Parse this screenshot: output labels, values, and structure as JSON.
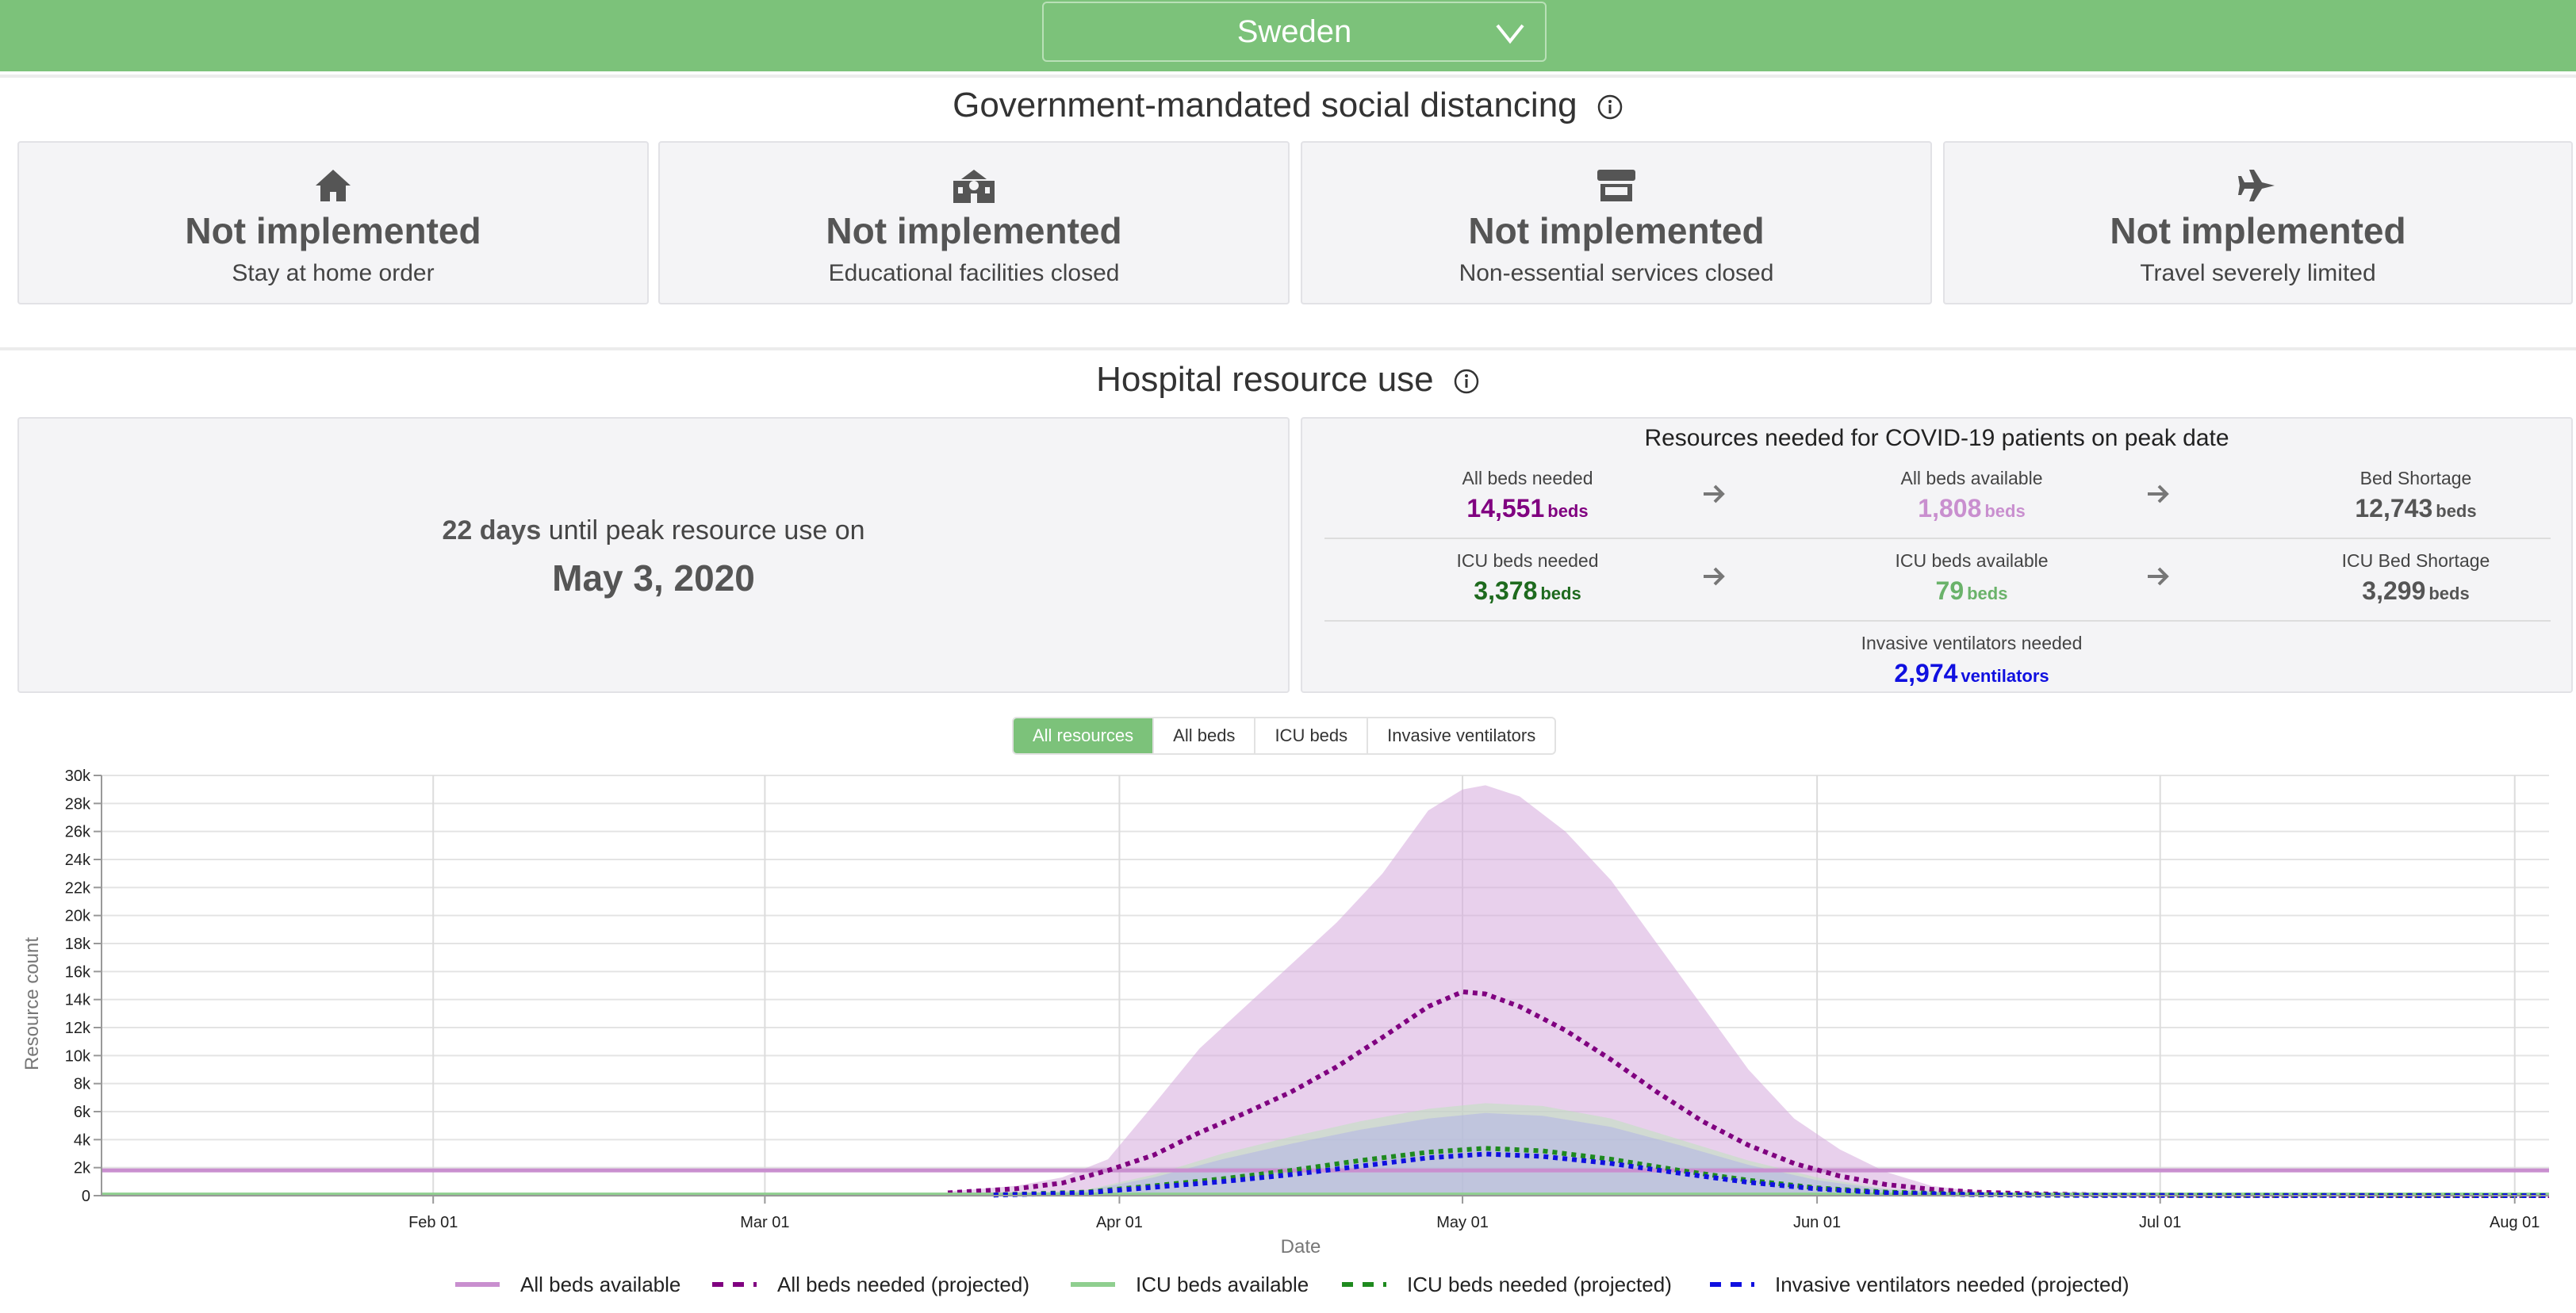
{
  "header": {
    "country": "Sweden"
  },
  "distancing": {
    "title": "Government-mandated social distancing",
    "cards": [
      {
        "icon": "home-icon",
        "status": "Not implemented",
        "label": "Stay at home order"
      },
      {
        "icon": "school-icon",
        "status": "Not implemented",
        "label": "Educational facilities closed"
      },
      {
        "icon": "store-icon",
        "status": "Not implemented",
        "label": "Non-essential services closed"
      },
      {
        "icon": "airplane-icon",
        "status": "Not implemented",
        "label": "Travel severely limited"
      }
    ]
  },
  "hospital": {
    "title": "Hospital resource use",
    "peak": {
      "days": "22 days",
      "text": "until peak resource use on",
      "date": "May 3, 2020"
    },
    "resources": {
      "title": "Resources needed for COVID-19 patients on peak date",
      "all_beds_needed": {
        "label": "All beds needed",
        "value": "14,551",
        "unit": "beds"
      },
      "all_beds_available": {
        "label": "All beds available",
        "value": "1,808",
        "unit": "beds"
      },
      "bed_shortage": {
        "label": "Bed Shortage",
        "value": "12,743",
        "unit": "beds"
      },
      "icu_beds_needed": {
        "label": "ICU beds needed",
        "value": "3,378",
        "unit": "beds"
      },
      "icu_beds_available": {
        "label": "ICU beds available",
        "value": "79",
        "unit": "beds"
      },
      "icu_bed_shortage": {
        "label": "ICU Bed Shortage",
        "value": "3,299",
        "unit": "beds"
      },
      "ventilators_needed": {
        "label": "Invasive ventilators needed",
        "value": "2,974",
        "unit": "ventilators"
      }
    },
    "tabs": [
      {
        "label": "All resources",
        "active": true
      },
      {
        "label": "All beds",
        "active": false
      },
      {
        "label": "ICU beds",
        "active": false
      },
      {
        "label": "Invasive ventilators",
        "active": false
      }
    ]
  },
  "colors": {
    "green": "#7cc27a",
    "all_beds": "#800080",
    "all_beds_band": "#e3c5e6",
    "icu_needed": "#1e8a1e",
    "icu_available": "#8fcf8f",
    "ventilators": "#1010e0",
    "ventilator_band": "#b6b6ee"
  },
  "chart_data": {
    "type": "line",
    "xlabel": "Date",
    "ylabel": "Resource count",
    "ylim": [
      0,
      30000
    ],
    "yticks": [
      "0",
      "2k",
      "4k",
      "6k",
      "8k",
      "10k",
      "12k",
      "14k",
      "16k",
      "18k",
      "20k",
      "22k",
      "24k",
      "26k",
      "28k",
      "30k"
    ],
    "xticks": [
      {
        "label": "Feb 01",
        "day": 31
      },
      {
        "label": "Mar 01",
        "day": 60
      },
      {
        "label": "Apr 01",
        "day": 91
      },
      {
        "label": "May 01",
        "day": 121
      },
      {
        "label": "Jun 01",
        "day": 152
      },
      {
        "label": "Jul 01",
        "day": 182
      },
      {
        "label": "Aug 01",
        "day": 213
      }
    ],
    "xlim_days": [
      2,
      216
    ],
    "grid": true,
    "legend_position": "bottom",
    "series": [
      {
        "name": "All beds available",
        "style": "solid",
        "color": "#c98fcf",
        "x": [
          2,
          216
        ],
        "y": [
          1808,
          1808
        ]
      },
      {
        "name": "All beds needed (projected)",
        "style": "dashed",
        "color": "#800080",
        "x": [
          76,
          82,
          86,
          90,
          94,
          98,
          102,
          106,
          110,
          114,
          118,
          121,
          123,
          126,
          130,
          134,
          138,
          142,
          146,
          150,
          154,
          158,
          162,
          166,
          170,
          176,
          182,
          216
        ],
        "y": [
          200,
          500,
          900,
          1800,
          2900,
          4500,
          5900,
          7400,
          9200,
          11300,
          13500,
          14551,
          14400,
          13500,
          11800,
          9700,
          7400,
          5300,
          3600,
          2300,
          1400,
          800,
          450,
          250,
          150,
          60,
          20,
          0
        ],
        "band_upper": [
          300,
          700,
          1300,
          2600,
          6500,
          10500,
          13500,
          16500,
          19500,
          23000,
          27500,
          29000,
          29300,
          28500,
          26000,
          22500,
          18000,
          13500,
          9000,
          5500,
          3300,
          1700,
          700,
          300,
          150,
          60,
          20,
          0
        ],
        "band_lower": [
          0,
          0,
          0,
          0,
          0,
          0,
          0,
          0,
          0,
          0,
          0,
          0,
          0,
          0,
          0,
          0,
          0,
          0,
          0,
          0,
          0,
          0,
          0,
          0,
          0,
          0,
          0,
          0
        ]
      },
      {
        "name": "ICU beds available",
        "style": "solid",
        "color": "#8fcf8f",
        "x": [
          2,
          216
        ],
        "y": [
          79,
          79
        ]
      },
      {
        "name": "ICU beds needed (projected)",
        "style": "dashed",
        "color": "#1e8a1e",
        "x": [
          80,
          88,
          94,
          100,
          106,
          112,
          118,
          123,
          128,
          134,
          140,
          146,
          152,
          158,
          166,
          176,
          216
        ],
        "y": [
          50,
          250,
          700,
          1200,
          1800,
          2500,
          3100,
          3378,
          3200,
          2600,
          1800,
          1100,
          550,
          250,
          80,
          20,
          0
        ],
        "band_upper": [
          80,
          400,
          1500,
          3000,
          4200,
          5300,
          6200,
          6600,
          6400,
          5500,
          4000,
          2500,
          1300,
          500,
          150,
          30,
          0
        ],
        "band_lower": [
          0,
          0,
          0,
          0,
          0,
          0,
          0,
          0,
          0,
          0,
          0,
          0,
          0,
          0,
          0,
          0,
          0
        ]
      },
      {
        "name": "Invasive ventilators needed (projected)",
        "style": "dashed",
        "color": "#1010e0",
        "x": [
          80,
          88,
          94,
          100,
          106,
          112,
          118,
          123,
          128,
          134,
          140,
          146,
          152,
          158,
          166,
          176,
          216
        ],
        "y": [
          40,
          200,
          600,
          1000,
          1500,
          2100,
          2700,
          2974,
          2800,
          2300,
          1600,
          950,
          480,
          200,
          70,
          15,
          0
        ],
        "band_upper": [
          60,
          350,
          1300,
          2600,
          3700,
          4700,
          5500,
          5900,
          5700,
          4900,
          3600,
          2200,
          1100,
          450,
          130,
          25,
          0
        ],
        "band_lower": [
          0,
          0,
          0,
          0,
          0,
          0,
          0,
          0,
          0,
          0,
          0,
          0,
          0,
          0,
          0,
          0,
          0
        ]
      }
    ]
  }
}
